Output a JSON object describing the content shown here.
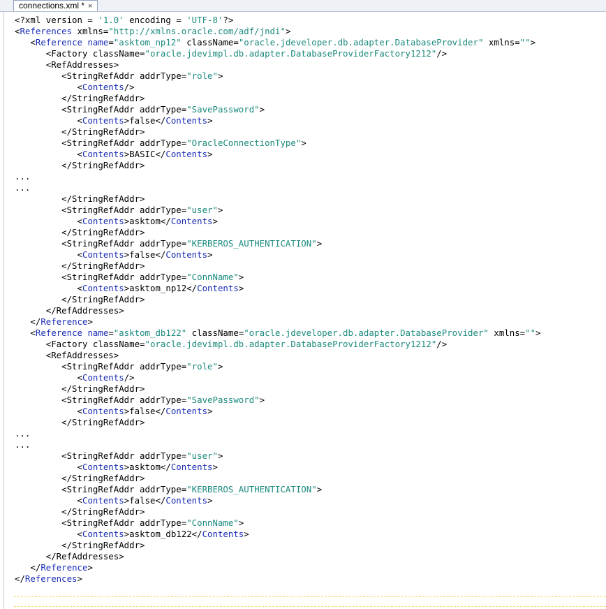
{
  "tab": {
    "title": "connections.xml *",
    "close_glyph": "×"
  },
  "lines": [
    {
      "indent": 0,
      "parts": [
        {
          "c": "plain",
          "t": "<?xml version = "
        },
        {
          "c": "v",
          "t": "'1.0'"
        },
        {
          "c": "plain",
          "t": " encoding = "
        },
        {
          "c": "v",
          "t": "'UTF-8'"
        },
        {
          "c": "plain",
          "t": "?>"
        }
      ]
    },
    {
      "indent": 0,
      "parts": [
        {
          "c": "plain",
          "t": "<"
        },
        {
          "c": "t",
          "t": "References"
        },
        {
          "c": "plain",
          "t": " xmlns="
        },
        {
          "c": "v",
          "t": "\"http://xmlns.oracle.com/adf/jndi\""
        },
        {
          "c": "plain",
          "t": ">"
        }
      ]
    },
    {
      "indent": 3,
      "parts": [
        {
          "c": "plain",
          "t": "<"
        },
        {
          "c": "t",
          "t": "Reference"
        },
        {
          "c": "plain",
          "t": " "
        },
        {
          "c": "t",
          "t": "name"
        },
        {
          "c": "plain",
          "t": "="
        },
        {
          "c": "v",
          "t": "\"asktom_np12\""
        },
        {
          "c": "plain",
          "t": " className="
        },
        {
          "c": "v",
          "t": "\"oracle.jdeveloper.db.adapter.DatabaseProvider\""
        },
        {
          "c": "plain",
          "t": " xmlns="
        },
        {
          "c": "v",
          "t": "\"\""
        },
        {
          "c": "plain",
          "t": ">"
        }
      ]
    },
    {
      "indent": 6,
      "parts": [
        {
          "c": "plain",
          "t": "<Factory className="
        },
        {
          "c": "v",
          "t": "\"oracle.jdevimpl.db.adapter.DatabaseProviderFactory1212\""
        },
        {
          "c": "plain",
          "t": "/>"
        }
      ]
    },
    {
      "indent": 6,
      "parts": [
        {
          "c": "plain",
          "t": "<RefAddresses>"
        }
      ]
    },
    {
      "indent": 9,
      "parts": [
        {
          "c": "plain",
          "t": "<StringRefAddr addrType="
        },
        {
          "c": "v",
          "t": "\"role\""
        },
        {
          "c": "plain",
          "t": ">"
        }
      ]
    },
    {
      "indent": 12,
      "parts": [
        {
          "c": "plain",
          "t": "<"
        },
        {
          "c": "t",
          "t": "Contents"
        },
        {
          "c": "plain",
          "t": "/>"
        }
      ]
    },
    {
      "indent": 9,
      "parts": [
        {
          "c": "plain",
          "t": "</StringRefAddr>"
        }
      ]
    },
    {
      "indent": 9,
      "parts": [
        {
          "c": "plain",
          "t": "<StringRefAddr addrType="
        },
        {
          "c": "v",
          "t": "\"SavePassword\""
        },
        {
          "c": "plain",
          "t": ">"
        }
      ]
    },
    {
      "indent": 12,
      "parts": [
        {
          "c": "plain",
          "t": "<"
        },
        {
          "c": "t",
          "t": "Contents"
        },
        {
          "c": "plain",
          "t": ">false</"
        },
        {
          "c": "t",
          "t": "Contents"
        },
        {
          "c": "plain",
          "t": ">"
        }
      ]
    },
    {
      "indent": 9,
      "parts": [
        {
          "c": "plain",
          "t": "</StringRefAddr>"
        }
      ]
    },
    {
      "indent": 9,
      "parts": [
        {
          "c": "plain",
          "t": "<StringRefAddr addrType="
        },
        {
          "c": "v",
          "t": "\"OracleConnectionType\""
        },
        {
          "c": "plain",
          "t": ">"
        }
      ]
    },
    {
      "indent": 12,
      "parts": [
        {
          "c": "plain",
          "t": "<"
        },
        {
          "c": "t",
          "t": "Contents"
        },
        {
          "c": "plain",
          "t": ">BASIC</"
        },
        {
          "c": "t",
          "t": "Contents"
        },
        {
          "c": "plain",
          "t": ">"
        }
      ]
    },
    {
      "indent": 9,
      "parts": [
        {
          "c": "plain",
          "t": "</StringRefAddr>"
        }
      ]
    },
    {
      "indent": 0,
      "parts": [
        {
          "c": "plain",
          "t": "..."
        }
      ]
    },
    {
      "indent": 0,
      "parts": [
        {
          "c": "plain",
          "t": "..."
        }
      ]
    },
    {
      "indent": 9,
      "parts": [
        {
          "c": "plain",
          "t": "</StringRefAddr>"
        }
      ]
    },
    {
      "indent": 9,
      "parts": [
        {
          "c": "plain",
          "t": "<StringRefAddr addrType="
        },
        {
          "c": "v",
          "t": "\"user\""
        },
        {
          "c": "plain",
          "t": ">"
        }
      ]
    },
    {
      "indent": 12,
      "parts": [
        {
          "c": "plain",
          "t": "<"
        },
        {
          "c": "t",
          "t": "Contents"
        },
        {
          "c": "plain",
          "t": ">asktom</"
        },
        {
          "c": "t",
          "t": "Contents"
        },
        {
          "c": "plain",
          "t": ">"
        }
      ]
    },
    {
      "indent": 9,
      "parts": [
        {
          "c": "plain",
          "t": "</StringRefAddr>"
        }
      ]
    },
    {
      "indent": 9,
      "parts": [
        {
          "c": "plain",
          "t": "<StringRefAddr addrType="
        },
        {
          "c": "v",
          "t": "\"KERBEROS_AUTHENTICATION\""
        },
        {
          "c": "plain",
          "t": ">"
        }
      ]
    },
    {
      "indent": 12,
      "parts": [
        {
          "c": "plain",
          "t": "<"
        },
        {
          "c": "t",
          "t": "Contents"
        },
        {
          "c": "plain",
          "t": ">false</"
        },
        {
          "c": "t",
          "t": "Contents"
        },
        {
          "c": "plain",
          "t": ">"
        }
      ]
    },
    {
      "indent": 9,
      "parts": [
        {
          "c": "plain",
          "t": "</StringRefAddr>"
        }
      ]
    },
    {
      "indent": 9,
      "parts": [
        {
          "c": "plain",
          "t": "<StringRefAddr addrType="
        },
        {
          "c": "v",
          "t": "\"ConnName\""
        },
        {
          "c": "plain",
          "t": ">"
        }
      ]
    },
    {
      "indent": 12,
      "parts": [
        {
          "c": "plain",
          "t": "<"
        },
        {
          "c": "t",
          "t": "Contents"
        },
        {
          "c": "plain",
          "t": ">asktom_np12</"
        },
        {
          "c": "t",
          "t": "Contents"
        },
        {
          "c": "plain",
          "t": ">"
        }
      ]
    },
    {
      "indent": 9,
      "parts": [
        {
          "c": "plain",
          "t": "</StringRefAddr>"
        }
      ]
    },
    {
      "indent": 6,
      "parts": [
        {
          "c": "plain",
          "t": "</RefAddresses>"
        }
      ]
    },
    {
      "indent": 3,
      "parts": [
        {
          "c": "plain",
          "t": "</"
        },
        {
          "c": "t",
          "t": "Reference"
        },
        {
          "c": "plain",
          "t": ">"
        }
      ]
    },
    {
      "indent": 3,
      "parts": [
        {
          "c": "plain",
          "t": "<"
        },
        {
          "c": "t",
          "t": "Reference"
        },
        {
          "c": "plain",
          "t": " "
        },
        {
          "c": "t",
          "t": "name"
        },
        {
          "c": "plain",
          "t": "="
        },
        {
          "c": "v",
          "t": "\"asktom_db122\""
        },
        {
          "c": "plain",
          "t": " className="
        },
        {
          "c": "v",
          "t": "\"oracle.jdeveloper.db.adapter.DatabaseProvider\""
        },
        {
          "c": "plain",
          "t": " xmlns="
        },
        {
          "c": "v",
          "t": "\"\""
        },
        {
          "c": "plain",
          "t": ">"
        }
      ]
    },
    {
      "indent": 6,
      "parts": [
        {
          "c": "plain",
          "t": "<Factory className="
        },
        {
          "c": "v",
          "t": "\"oracle.jdevimpl.db.adapter.DatabaseProviderFactory1212\""
        },
        {
          "c": "plain",
          "t": "/>"
        }
      ]
    },
    {
      "indent": 6,
      "parts": [
        {
          "c": "plain",
          "t": "<RefAddresses>"
        }
      ]
    },
    {
      "indent": 9,
      "parts": [
        {
          "c": "plain",
          "t": "<StringRefAddr addrType="
        },
        {
          "c": "v",
          "t": "\"role\""
        },
        {
          "c": "plain",
          "t": ">"
        }
      ]
    },
    {
      "indent": 12,
      "parts": [
        {
          "c": "plain",
          "t": "<"
        },
        {
          "c": "t",
          "t": "Contents"
        },
        {
          "c": "plain",
          "t": "/>"
        }
      ]
    },
    {
      "indent": 9,
      "parts": [
        {
          "c": "plain",
          "t": "</StringRefAddr>"
        }
      ]
    },
    {
      "indent": 9,
      "parts": [
        {
          "c": "plain",
          "t": "<StringRefAddr addrType="
        },
        {
          "c": "v",
          "t": "\"SavePassword\""
        },
        {
          "c": "plain",
          "t": ">"
        }
      ]
    },
    {
      "indent": 12,
      "parts": [
        {
          "c": "plain",
          "t": "<"
        },
        {
          "c": "t",
          "t": "Contents"
        },
        {
          "c": "plain",
          "t": ">false</"
        },
        {
          "c": "t",
          "t": "Contents"
        },
        {
          "c": "plain",
          "t": ">"
        }
      ]
    },
    {
      "indent": 9,
      "parts": [
        {
          "c": "plain",
          "t": "</StringRefAddr>"
        }
      ]
    },
    {
      "indent": 0,
      "parts": [
        {
          "c": "plain",
          "t": "..."
        }
      ]
    },
    {
      "indent": 0,
      "parts": [
        {
          "c": "plain",
          "t": "..."
        }
      ]
    },
    {
      "indent": 9,
      "parts": [
        {
          "c": "plain",
          "t": "<StringRefAddr addrType="
        },
        {
          "c": "v",
          "t": "\"user\""
        },
        {
          "c": "plain",
          "t": ">"
        }
      ]
    },
    {
      "indent": 12,
      "parts": [
        {
          "c": "plain",
          "t": "<"
        },
        {
          "c": "t",
          "t": "Contents"
        },
        {
          "c": "plain",
          "t": ">asktom</"
        },
        {
          "c": "t",
          "t": "Contents"
        },
        {
          "c": "plain",
          "t": ">"
        }
      ]
    },
    {
      "indent": 9,
      "parts": [
        {
          "c": "plain",
          "t": "</StringRefAddr>"
        }
      ]
    },
    {
      "indent": 9,
      "parts": [
        {
          "c": "plain",
          "t": "<StringRefAddr addrType="
        },
        {
          "c": "v",
          "t": "\"KERBEROS_AUTHENTICATION\""
        },
        {
          "c": "plain",
          "t": ">"
        }
      ]
    },
    {
      "indent": 12,
      "parts": [
        {
          "c": "plain",
          "t": "<"
        },
        {
          "c": "t",
          "t": "Contents"
        },
        {
          "c": "plain",
          "t": ">false</"
        },
        {
          "c": "t",
          "t": "Contents"
        },
        {
          "c": "plain",
          "t": ">"
        }
      ]
    },
    {
      "indent": 9,
      "parts": [
        {
          "c": "plain",
          "t": "</StringRefAddr>"
        }
      ]
    },
    {
      "indent": 9,
      "parts": [
        {
          "c": "plain",
          "t": "<StringRefAddr addrType="
        },
        {
          "c": "v",
          "t": "\"ConnName\""
        },
        {
          "c": "plain",
          "t": ">"
        }
      ]
    },
    {
      "indent": 12,
      "parts": [
        {
          "c": "plain",
          "t": "<"
        },
        {
          "c": "t",
          "t": "Contents"
        },
        {
          "c": "plain",
          "t": ">asktom_db122</"
        },
        {
          "c": "t",
          "t": "Contents"
        },
        {
          "c": "plain",
          "t": ">"
        }
      ]
    },
    {
      "indent": 9,
      "parts": [
        {
          "c": "plain",
          "t": "</StringRefAddr>"
        }
      ]
    },
    {
      "indent": 6,
      "parts": [
        {
          "c": "plain",
          "t": "</RefAddresses>"
        }
      ]
    },
    {
      "indent": 3,
      "parts": [
        {
          "c": "plain",
          "t": "</"
        },
        {
          "c": "t",
          "t": "Reference"
        },
        {
          "c": "plain",
          "t": ">"
        }
      ]
    },
    {
      "indent": 0,
      "parts": [
        {
          "c": "plain",
          "t": "</"
        },
        {
          "c": "t",
          "t": "References"
        },
        {
          "c": "plain",
          "t": ">"
        }
      ]
    }
  ],
  "colors": {
    "tag": "#1a2cb5",
    "value": "#1b8a7e",
    "text": "#000000",
    "current_line_marker": "#f1d76a"
  }
}
